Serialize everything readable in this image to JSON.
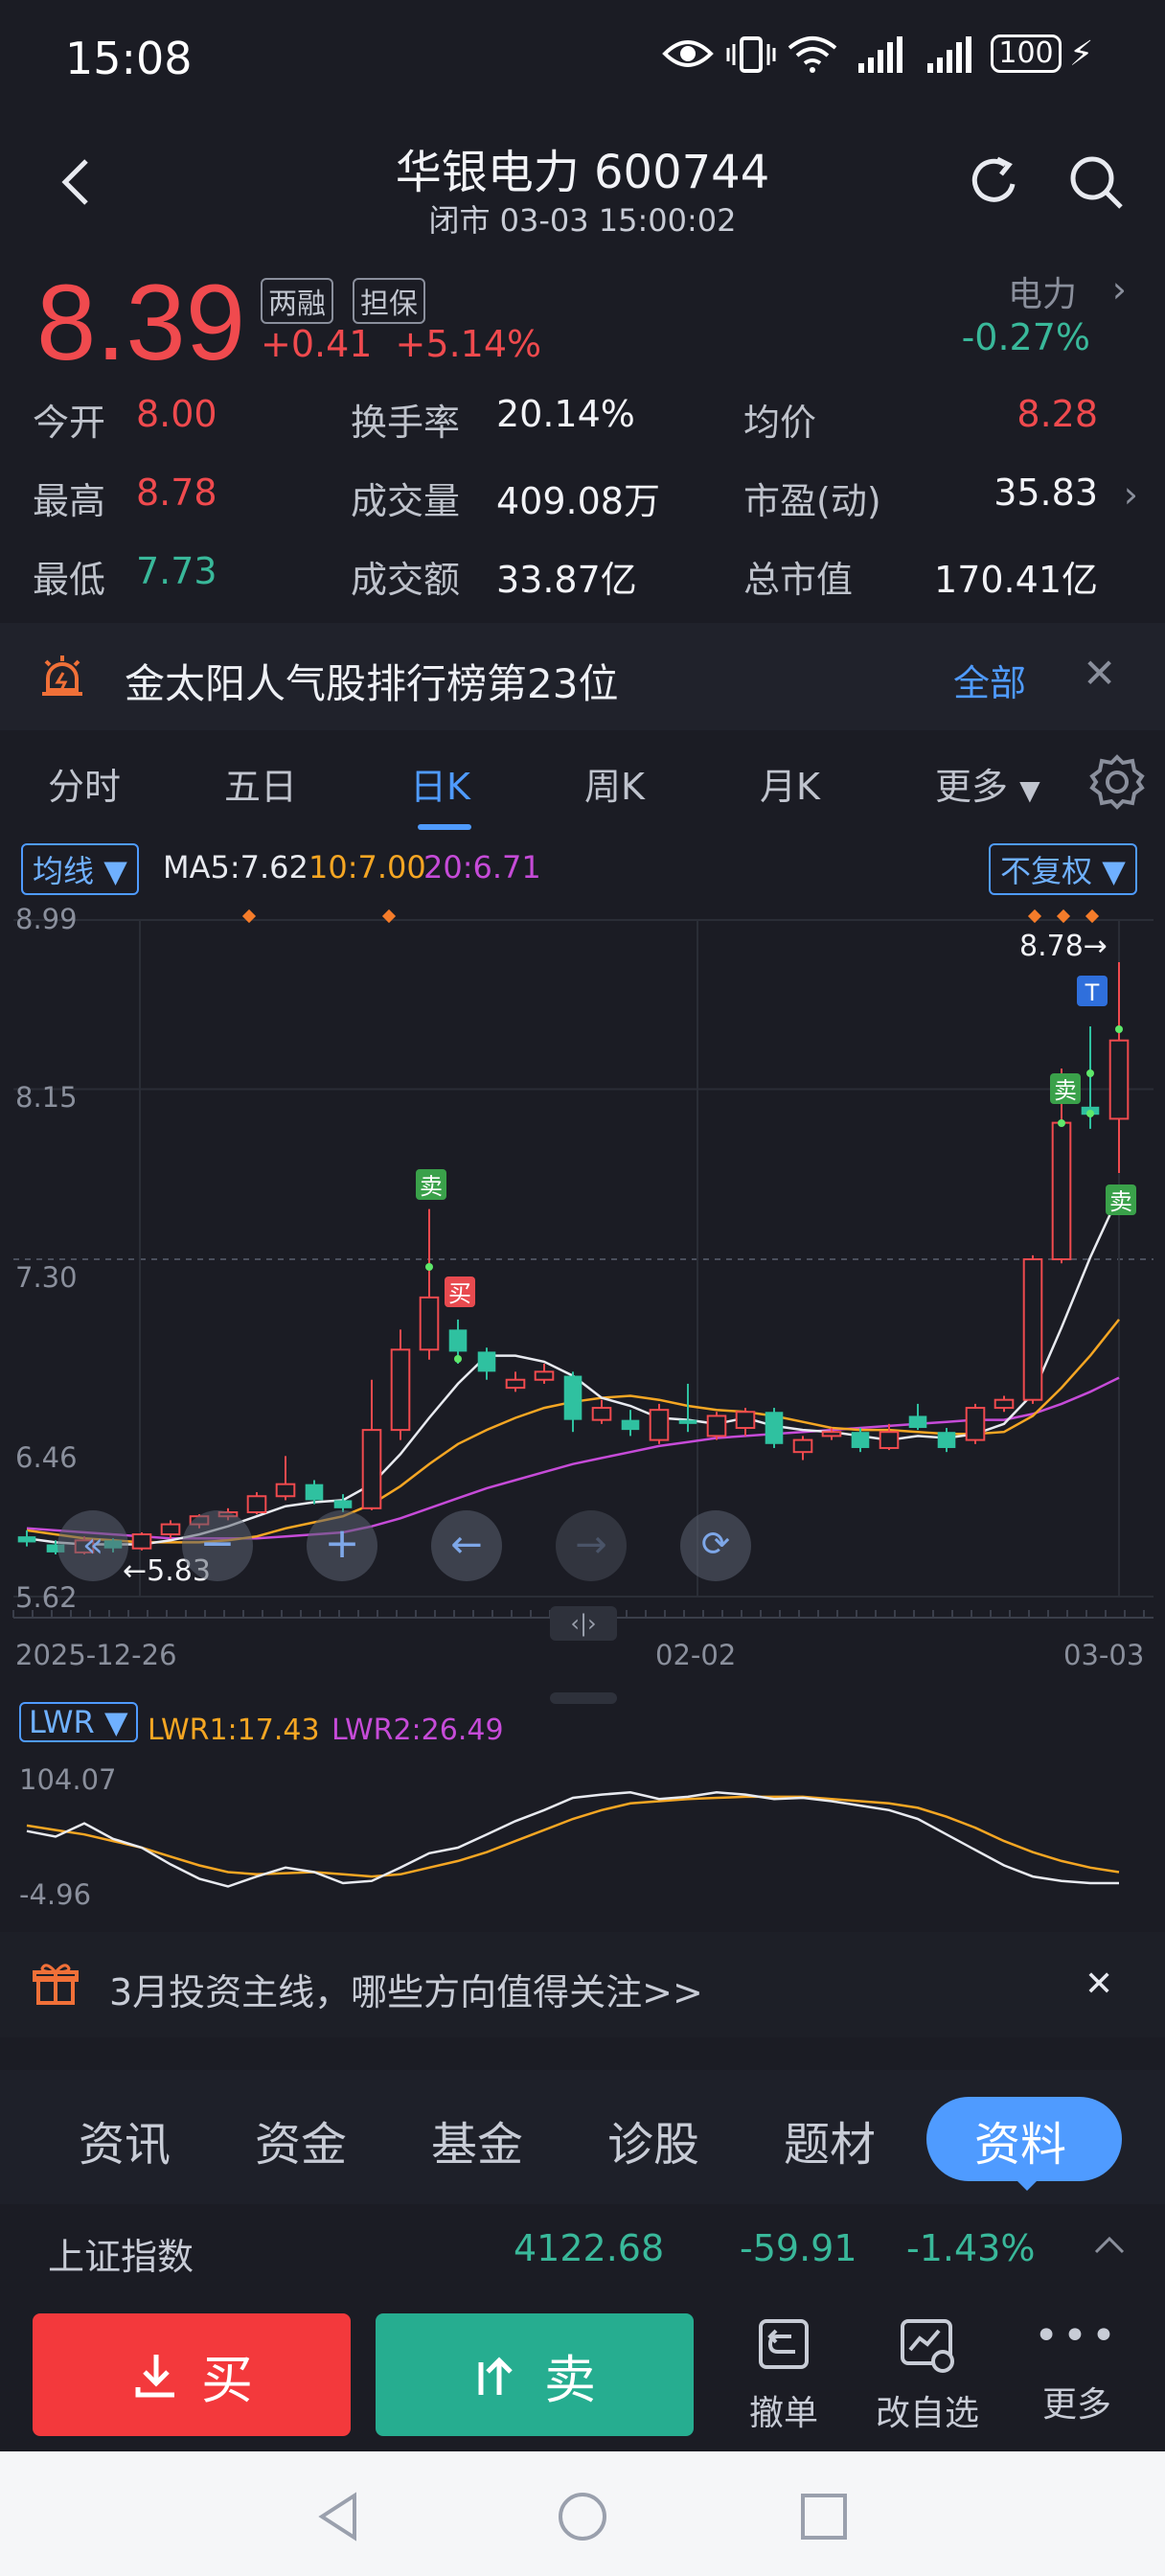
{
  "status_bar": {
    "time": "15:08",
    "battery": "100"
  },
  "header": {
    "title": "华银电力 600744",
    "subtitle": "闭市 03-03 15:00:02"
  },
  "quote": {
    "price": "8.39",
    "tag1": "两融",
    "tag2": "担保",
    "change": "+0.41",
    "change_pct": "+5.14%",
    "sector": "电力",
    "sector_pct": "-0.27%"
  },
  "stats": {
    "open_label": "今开",
    "open": "8.00",
    "high_label": "最高",
    "high": "8.78",
    "low_label": "最低",
    "low": "7.73",
    "turnover_label": "换手率",
    "turnover": "20.14%",
    "volume_label": "成交量",
    "volume": "409.08万",
    "amount_label": "成交额",
    "amount": "33.87亿",
    "avg_label": "均价",
    "avg": "8.28",
    "pe_label": "市盈(动)",
    "pe": "35.83",
    "mcap_label": "总市值",
    "mcap": "170.41亿"
  },
  "banner": {
    "text": "金太阳人气股排行榜第23位",
    "all": "全部",
    "close": "✕"
  },
  "chart_tabs": [
    "分时",
    "五日",
    "日K",
    "周K",
    "月K",
    "更多"
  ],
  "ma_row": {
    "ma_select": "均线",
    "ma5": "MA5:7.62",
    "ma10": "10:7.00",
    "ma20": "20:6.71",
    "adj": "不复权"
  },
  "chart_data": {
    "type": "candlestick",
    "y_ticks": [
      "8.99",
      "8.15",
      "7.30",
      "6.46",
      "5.62"
    ],
    "ylim": [
      5.62,
      8.99
    ],
    "x_ticks": [
      "2025-12-26",
      "02-02",
      "03-03"
    ],
    "high_marker": "8.78→",
    "low_marker": "←5.83",
    "buy_label": "买",
    "sell_label": "卖",
    "t_label": "T",
    "candles": [
      {
        "o": 5.92,
        "c": 5.89,
        "h": 5.95,
        "l": 5.87
      },
      {
        "o": 5.88,
        "c": 5.84,
        "h": 5.9,
        "l": 5.83
      },
      {
        "o": 5.84,
        "c": 5.9,
        "h": 5.92,
        "l": 5.83
      },
      {
        "o": 5.9,
        "c": 5.86,
        "h": 5.91,
        "l": 5.84
      },
      {
        "o": 5.86,
        "c": 5.93,
        "h": 5.94,
        "l": 5.85
      },
      {
        "o": 5.93,
        "c": 5.98,
        "h": 6.0,
        "l": 5.91
      },
      {
        "o": 5.98,
        "c": 6.02,
        "h": 6.03,
        "l": 5.96
      },
      {
        "o": 6.02,
        "c": 6.04,
        "h": 6.06,
        "l": 6.0
      },
      {
        "o": 6.04,
        "c": 6.12,
        "h": 6.14,
        "l": 6.03
      },
      {
        "o": 6.12,
        "c": 6.18,
        "h": 6.32,
        "l": 6.1
      },
      {
        "o": 6.18,
        "c": 6.1,
        "h": 6.2,
        "l": 6.08
      },
      {
        "o": 6.1,
        "c": 6.06,
        "h": 6.13,
        "l": 6.04
      },
      {
        "o": 6.06,
        "c": 6.45,
        "h": 6.7,
        "l": 6.05
      },
      {
        "o": 6.45,
        "c": 6.85,
        "h": 6.95,
        "l": 6.4
      },
      {
        "o": 6.85,
        "c": 7.11,
        "h": 7.55,
        "l": 6.8
      },
      {
        "o": 6.95,
        "c": 6.84,
        "h": 7.0,
        "l": 6.78
      },
      {
        "o": 6.84,
        "c": 6.74,
        "h": 6.86,
        "l": 6.7
      },
      {
        "o": 6.66,
        "c": 6.7,
        "h": 6.74,
        "l": 6.64
      },
      {
        "o": 6.7,
        "c": 6.74,
        "h": 6.78,
        "l": 6.68
      },
      {
        "o": 6.72,
        "c": 6.5,
        "h": 6.74,
        "l": 6.44
      },
      {
        "o": 6.5,
        "c": 6.56,
        "h": 6.6,
        "l": 6.48
      },
      {
        "o": 6.5,
        "c": 6.45,
        "h": 6.55,
        "l": 6.42
      },
      {
        "o": 6.4,
        "c": 6.55,
        "h": 6.58,
        "l": 6.38
      },
      {
        "o": 6.5,
        "c": 6.48,
        "h": 6.68,
        "l": 6.44
      },
      {
        "o": 6.42,
        "c": 6.52,
        "h": 6.54,
        "l": 6.4
      },
      {
        "o": 6.46,
        "c": 6.54,
        "h": 6.56,
        "l": 6.42
      },
      {
        "o": 6.54,
        "c": 6.38,
        "h": 6.56,
        "l": 6.36
      },
      {
        "o": 6.34,
        "c": 6.4,
        "h": 6.42,
        "l": 6.3
      },
      {
        "o": 6.42,
        "c": 6.44,
        "h": 6.46,
        "l": 6.4
      },
      {
        "o": 6.44,
        "c": 6.36,
        "h": 6.46,
        "l": 6.34
      },
      {
        "o": 6.36,
        "c": 6.44,
        "h": 6.48,
        "l": 6.35
      },
      {
        "o": 6.52,
        "c": 6.46,
        "h": 6.58,
        "l": 6.45
      },
      {
        "o": 6.44,
        "c": 6.36,
        "h": 6.46,
        "l": 6.34
      },
      {
        "o": 6.4,
        "c": 6.56,
        "h": 6.58,
        "l": 6.38
      },
      {
        "o": 6.56,
        "c": 6.6,
        "h": 6.62,
        "l": 6.54
      },
      {
        "o": 6.6,
        "c": 7.3,
        "h": 7.32,
        "l": 6.58
      },
      {
        "o": 7.3,
        "c": 7.98,
        "h": 8.25,
        "l": 7.28
      },
      {
        "o": 8.06,
        "c": 8.02,
        "h": 8.46,
        "l": 7.95
      },
      {
        "o": 8.0,
        "c": 8.39,
        "h": 8.78,
        "l": 7.73
      }
    ],
    "ma5": [
      5.91,
      5.89,
      5.88,
      5.88,
      5.88,
      5.9,
      5.93,
      5.97,
      6.02,
      6.07,
      6.09,
      6.1,
      6.18,
      6.33,
      6.51,
      6.68,
      6.82,
      6.82,
      6.79,
      6.72,
      6.61,
      6.57,
      6.51,
      6.5,
      6.48,
      6.51,
      6.47,
      6.45,
      6.44,
      6.42,
      6.4,
      6.42,
      6.41,
      6.43,
      6.48,
      6.63,
      6.96,
      7.31,
      7.62
    ],
    "ma10": [
      5.95,
      5.93,
      5.91,
      5.9,
      5.89,
      5.89,
      5.89,
      5.9,
      5.92,
      5.96,
      5.99,
      6.02,
      6.08,
      6.17,
      6.28,
      6.38,
      6.45,
      6.51,
      6.56,
      6.59,
      6.61,
      6.62,
      6.6,
      6.57,
      6.55,
      6.54,
      6.52,
      6.49,
      6.46,
      6.45,
      6.45,
      6.44,
      6.43,
      6.43,
      6.44,
      6.52,
      6.66,
      6.82,
      7.0
    ],
    "ma20": [
      5.96,
      5.95,
      5.94,
      5.93,
      5.92,
      5.91,
      5.91,
      5.91,
      5.91,
      5.92,
      5.93,
      5.94,
      5.97,
      6.01,
      6.06,
      6.11,
      6.16,
      6.2,
      6.24,
      6.28,
      6.31,
      6.34,
      6.37,
      6.39,
      6.41,
      6.42,
      6.43,
      6.44,
      6.45,
      6.46,
      6.47,
      6.48,
      6.49,
      6.5,
      6.5,
      6.53,
      6.58,
      6.64,
      6.71
    ]
  },
  "lwr": {
    "select": "LWR",
    "lwr1": "LWR1:17.43",
    "lwr2": "LWR2:26.49",
    "y_max": "104.07",
    "y_min": "-4.96",
    "range": [
      -4.96,
      104.07
    ],
    "lwr1_values": [
      55,
      50,
      62,
      48,
      40,
      25,
      12,
      5,
      14,
      22,
      18,
      8,
      10,
      22,
      35,
      40,
      52,
      64,
      74,
      85,
      88,
      90,
      84,
      86,
      90,
      88,
      84,
      85,
      82,
      78,
      74,
      66,
      52,
      38,
      24,
      14,
      10,
      8,
      8
    ],
    "lwr2_values": [
      60,
      56,
      52,
      46,
      40,
      32,
      24,
      18,
      16,
      17,
      18,
      16,
      14,
      16,
      22,
      28,
      36,
      46,
      56,
      66,
      74,
      80,
      82,
      84,
      85,
      86,
      86,
      86,
      84,
      82,
      80,
      76,
      68,
      58,
      46,
      36,
      28,
      22,
      18
    ]
  },
  "notice": {
    "text": "3月投资主线，哪些方向值得关注>>",
    "close": "✕"
  },
  "info_tabs": [
    "资讯",
    "资金",
    "基金",
    "诊股",
    "题材",
    "资料"
  ],
  "index_row": {
    "name": "上证指数",
    "value": "4122.68",
    "change": "-59.91",
    "pct": "-1.43%"
  },
  "actions": {
    "buy": "买",
    "sell": "卖",
    "undo": "撤单",
    "watch": "改自选",
    "more": "更多"
  }
}
